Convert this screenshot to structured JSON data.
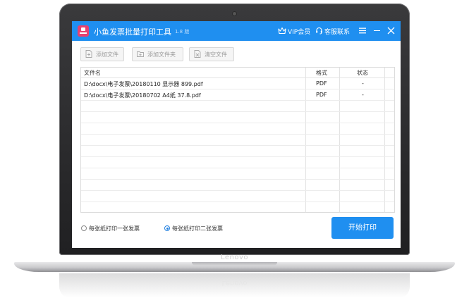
{
  "device": {
    "brand": "Lenovo"
  },
  "app": {
    "title": "小鱼发票批量打印工具",
    "version": "1.8 版",
    "vip_label": "VIP会员",
    "service_label": "客服联系",
    "accent_color": "#1f8ff0",
    "logo_color": "#e8416f"
  },
  "toolbar": {
    "add_file_label": "添加文件",
    "add_folder_label": "添加文件夹",
    "clear_label": "清空文件"
  },
  "table": {
    "columns": [
      "文件名",
      "格式",
      "状态"
    ],
    "rows": [
      {
        "name": "D:\\docx\\电子发票\\20180110 显示器 899.pdf",
        "format": "PDF",
        "status": "-"
      },
      {
        "name": "D:\\docx\\电子发票\\20180702 A4纸 37.8.pdf",
        "format": "PDF",
        "status": "-"
      }
    ]
  },
  "options": {
    "one_per_page_label": "每张纸打印一张发票",
    "two_per_page_label": "每张纸打印二张发票",
    "selected": "two_per_page"
  },
  "start_button_label": "开始打印"
}
